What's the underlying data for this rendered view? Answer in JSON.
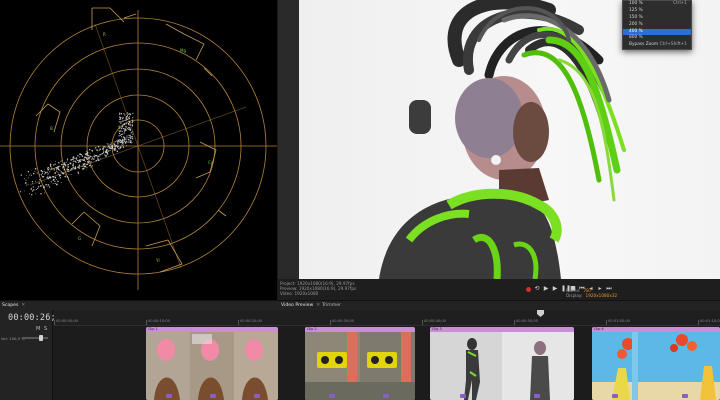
{
  "scope": {
    "vector_labels": [
      {
        "name": "R"
      },
      {
        "name": "Mg"
      },
      {
        "name": "B"
      },
      {
        "name": "Cy"
      },
      {
        "name": "G"
      },
      {
        "name": "Yl"
      }
    ]
  },
  "zoom_menu": {
    "items": [
      {
        "label": "100 %",
        "shortcut": "Ctrl+1"
      },
      {
        "label": "125 %",
        "shortcut": ""
      },
      {
        "label": "150 %",
        "shortcut": ""
      },
      {
        "label": "200 %",
        "shortcut": ""
      },
      {
        "label": "400 %",
        "shortcut": ""
      },
      {
        "label": "800 %",
        "shortcut": ""
      },
      {
        "label": "Bypass Zoom",
        "shortcut": "Ctrl+Shift+1"
      }
    ],
    "selected_index": 4
  },
  "preview_info": {
    "project": "Project: 1920x1080(16:9), 29.97fps",
    "preview": "Preview: 1920x1080(16:9), 29.97fps",
    "video": "Video: 1920x1080",
    "frame_label": "Frame:",
    "frame_value": "787",
    "display_label": "Display:",
    "display_value": "1920x1080x32"
  },
  "panel_tabs": {
    "scopes": "Scopes",
    "video_preview": "Video Preview",
    "trimmer": "Trimmer"
  },
  "timeline": {
    "timecode": "00:00:26;17",
    "mute_label": "M",
    "solo_label": "S",
    "volume_label": "Vol: 100,0 %",
    "volume_level": 0.75,
    "ruler_labels": [
      "00:00:00;00",
      "00:00:10;00",
      "00:00:20;00",
      "00:00:30;00",
      "00:00:40;00",
      "00:00:50;00",
      "00:01:00;00",
      "00:01:10;00"
    ],
    "clips": [
      {
        "name": "Clip 1",
        "theme": "beach"
      },
      {
        "name": "Clip 2",
        "theme": "boombox"
      },
      {
        "name": "Clip 3",
        "theme": "studio"
      },
      {
        "name": "Clip 4",
        "theme": "balloons"
      }
    ]
  },
  "colors": {
    "accent": "#2b6fd6",
    "record": "#e02a2a",
    "graticule": "#b3833a",
    "clip_header": "#c98ed6",
    "display_value": "#e89630"
  }
}
